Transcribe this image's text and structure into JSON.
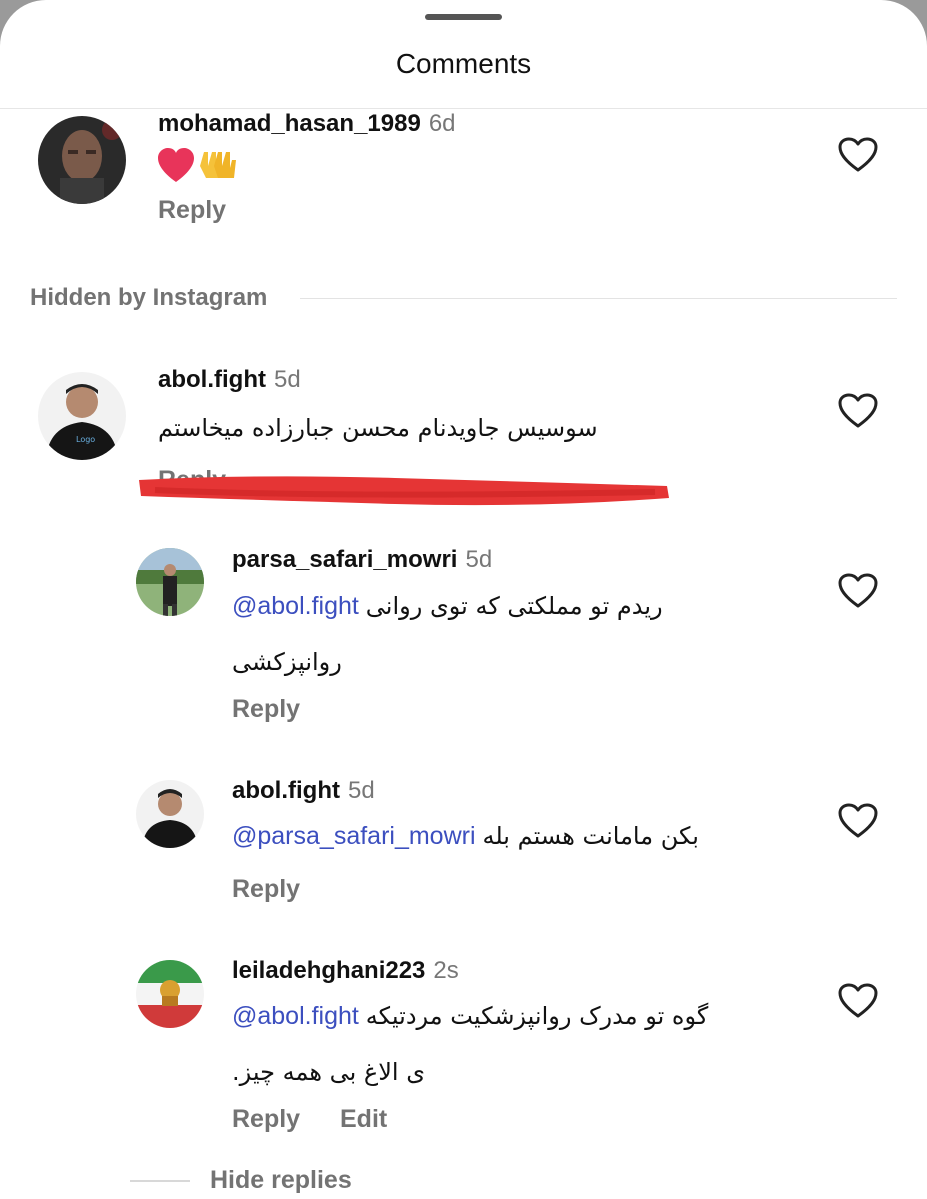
{
  "header": {
    "title": "Comments"
  },
  "comments": [
    {
      "username": "mohamad_hasan_1989",
      "time": "6d",
      "text": "",
      "emoji_names": [
        "heart",
        "raising-hands"
      ],
      "reply_label": "Reply"
    },
    {
      "username": "abol.fight",
      "time": "5d",
      "text": "سوسیس جاویدنام محسن جبارزاده میخاستم",
      "reply_label": "Reply"
    }
  ],
  "hidden_section": {
    "label": "Hidden by Instagram"
  },
  "replies": [
    {
      "username": "parsa_safari_mowri",
      "time": "5d",
      "mention": "@abol.fight",
      "text_line1": "ریدم تو مملکتی که توی روانی",
      "text_line2": "روانپزکشی",
      "reply_label": "Reply"
    },
    {
      "username": "abol.fight",
      "time": "5d",
      "mention": "@parsa_safari_mowri",
      "text_line1": "بکن مامانت هستم بله",
      "reply_label": "Reply"
    },
    {
      "username": "leiladehghani223",
      "time": "2s",
      "mention": "@abol.fight",
      "text_line1": "گوه تو مدرک روانپزشکیت مردتیکه",
      "text_line2": "ی الاغ بی همه چیز.",
      "reply_label": "Reply",
      "edit_label": "Edit"
    }
  ],
  "footer": {
    "hide_replies_label": "Hide replies"
  },
  "colors": {
    "mention": "#3c4fbf",
    "muted": "#737373",
    "redact": "#e53535"
  }
}
